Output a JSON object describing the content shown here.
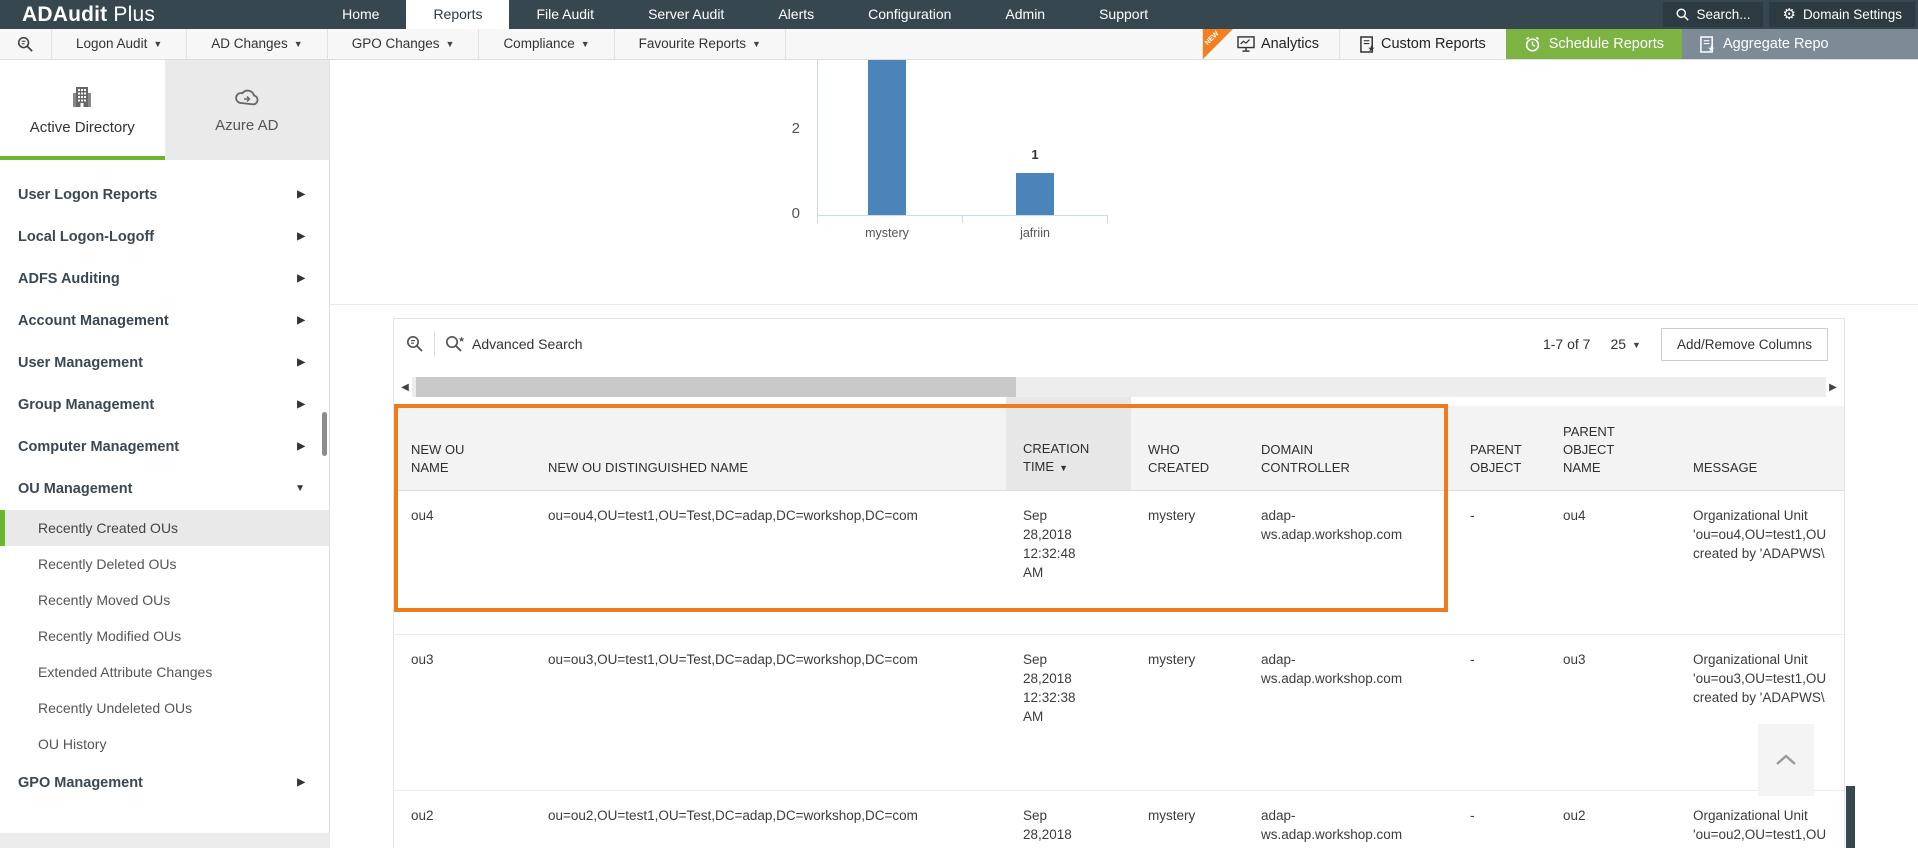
{
  "topbar": {
    "logo_strong": "ADAudit",
    "logo_light": " Plus",
    "nav": [
      {
        "label": "Home"
      },
      {
        "label": "Reports"
      },
      {
        "label": "File Audit"
      },
      {
        "label": "Server Audit"
      },
      {
        "label": "Alerts"
      },
      {
        "label": "Configuration"
      },
      {
        "label": "Admin"
      },
      {
        "label": "Support"
      }
    ],
    "search_label": "Search...",
    "domain_settings_label": "Domain Settings"
  },
  "toolbar": {
    "menus": [
      {
        "label": "Logon Audit"
      },
      {
        "label": "AD Changes"
      },
      {
        "label": "GPO Changes"
      },
      {
        "label": "Compliance"
      },
      {
        "label": "Favourite Reports"
      }
    ],
    "new_badge": "NEW",
    "analytics_label": "Analytics",
    "custom_reports_label": "Custom Reports",
    "schedule_reports_label": "Schedule Reports",
    "aggregate_reports_label": "Aggregate Repo"
  },
  "sidebar": {
    "tabs": [
      {
        "label": "Active Directory",
        "active": true
      },
      {
        "label": "Azure AD",
        "active": false
      }
    ],
    "items": [
      {
        "label": "User Logon Reports"
      },
      {
        "label": "Local Logon-Logoff"
      },
      {
        "label": "ADFS Auditing"
      },
      {
        "label": "Account Management"
      },
      {
        "label": "User Management"
      },
      {
        "label": "Group Management"
      },
      {
        "label": "Computer Management"
      },
      {
        "label": "OU Management",
        "expanded": true
      }
    ],
    "ou_children": [
      {
        "label": "Recently Created OUs",
        "selected": true
      },
      {
        "label": "Recently Deleted OUs"
      },
      {
        "label": "Recently Moved OUs"
      },
      {
        "label": "Recently Modified OUs"
      },
      {
        "label": "Extended Attribute Changes"
      },
      {
        "label": "Recently Undeleted OUs"
      },
      {
        "label": "OU History"
      }
    ],
    "items_after": [
      {
        "label": "GPO Management"
      }
    ]
  },
  "chart_data": {
    "type": "bar",
    "categories": [
      "mystery",
      "jafriin"
    ],
    "values": [
      6,
      1
    ],
    "visible_value_labels": [
      "",
      "1"
    ],
    "yticks": [
      0,
      2
    ],
    "ylim": [
      0,
      6
    ],
    "bar_color": "#4a84b8",
    "note": "mystery bar is clipped by the top edge of the scrolled viewport; only jafriin's data label '1' is visible"
  },
  "table": {
    "advanced_search_label": "Advanced Search",
    "record_count": "1-7 of 7",
    "page_size": "25",
    "add_remove_label": "Add/Remove Columns",
    "columns": [
      {
        "label": "NEW OU NAME"
      },
      {
        "label": "NEW OU DISTINGUISHED NAME"
      },
      {
        "label": "CREATION TIME",
        "sorted": "desc"
      },
      {
        "label": "WHO CREATED"
      },
      {
        "label": "DOMAIN CONTROLLER"
      },
      {
        "label": "PARENT OBJECT"
      },
      {
        "label": "PARENT OBJECT NAME"
      },
      {
        "label": "MESSAGE"
      }
    ],
    "rows": [
      {
        "new_ou_name": "ou4",
        "dn": "ou=ou4,OU=test1,OU=Test,DC=adap,DC=workshop,DC=com",
        "creation_time": "Sep 28,2018 12:32:48 AM",
        "who_created": "mystery",
        "domain_controller": "adap-ws.adap.workshop.com",
        "parent_object": "-",
        "parent_object_name": "ou4",
        "message_lines": [
          "Organizational Unit",
          "'ou=ou4,OU=test1,OU",
          "created by 'ADAPWS\\"
        ]
      },
      {
        "new_ou_name": "ou3",
        "dn": "ou=ou3,OU=test1,OU=Test,DC=adap,DC=workshop,DC=com",
        "creation_time": "Sep 28,2018 12:32:38 AM",
        "who_created": "mystery",
        "domain_controller": "adap-ws.adap.workshop.com",
        "parent_object": "-",
        "parent_object_name": "ou3",
        "message_lines": [
          "Organizational Unit",
          "'ou=ou3,OU=test1,OU",
          "created by 'ADAPWS\\"
        ]
      },
      {
        "new_ou_name": "ou2",
        "dn": "ou=ou2,OU=test1,OU=Test,DC=adap,DC=workshop,DC=com",
        "creation_time": "Sep 28,2018",
        "who_created": "mystery",
        "domain_controller": "adap-ws.adap.workshop.com",
        "parent_object": "-",
        "parent_object_name": "ou2",
        "message_lines": [
          "Organizational Unit",
          "'ou=ou2,OU=test1,OU"
        ]
      }
    ]
  },
  "colors": {
    "topbar_dark": "#37474f",
    "accent_green": "#6cb52e",
    "schedule_green": "#7cb342",
    "aggregate_slate": "#7d8b96",
    "highlight_orange": "#ee7c1d",
    "bar_blue": "#4a84b8"
  }
}
